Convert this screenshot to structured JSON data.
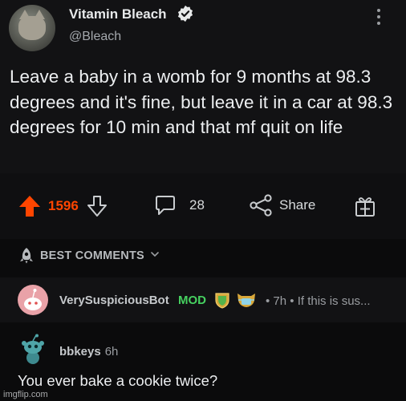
{
  "tweet": {
    "display_name": "Vitamin Bleach",
    "handle": "@Bleach",
    "text": "Leave a baby in a womb for 9 months at 98.3 degrees and it's fine, but leave it in a car at 98.3 degrees for 10 min and that mf quit on life",
    "icons": {
      "verified": "verified-badge-icon",
      "more": "more-vertical-icon"
    }
  },
  "actions": {
    "vote_count": "1596",
    "comment_count": "28",
    "share_label": "Share",
    "colors": {
      "upvote": "#ff4500"
    }
  },
  "comments_sort": {
    "label": "BEST COMMENTS"
  },
  "bot_comment": {
    "username": "VerySuspiciousBot",
    "flair": "MOD",
    "meta": "• 7h • If this is sus...",
    "colors": {
      "mod": "#46d160"
    }
  },
  "reply": {
    "username": "bbkeys",
    "time": "6h",
    "text": "You ever bake a cookie twice?"
  },
  "watermark": "imgflip.com"
}
